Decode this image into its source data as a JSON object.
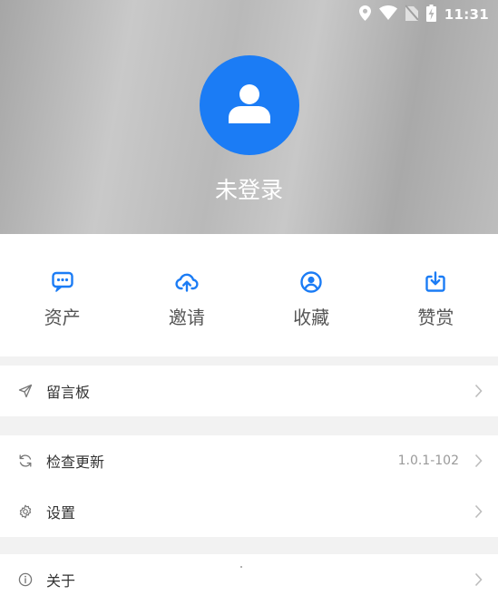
{
  "status": {
    "time": "11:31"
  },
  "profile": {
    "login_text": "未登录"
  },
  "quick_actions": [
    {
      "label": "资产",
      "icon": "chat-bubble-icon"
    },
    {
      "label": "邀请",
      "icon": "cloud-upload-icon"
    },
    {
      "label": "收藏",
      "icon": "user-circle-icon"
    },
    {
      "label": "赞赏",
      "icon": "download-box-icon"
    }
  ],
  "menu": {
    "message_board": {
      "label": "留言板",
      "icon": "send-icon"
    },
    "check_update": {
      "label": "检查更新",
      "value": "1.0.1-102",
      "icon": "refresh-icon"
    },
    "settings": {
      "label": "设置",
      "icon": "gear-icon"
    },
    "about": {
      "label": "关于",
      "icon": "info-icon"
    }
  },
  "colors": {
    "accent": "#1b7cf5",
    "header_gray": "#bdbdbd"
  }
}
